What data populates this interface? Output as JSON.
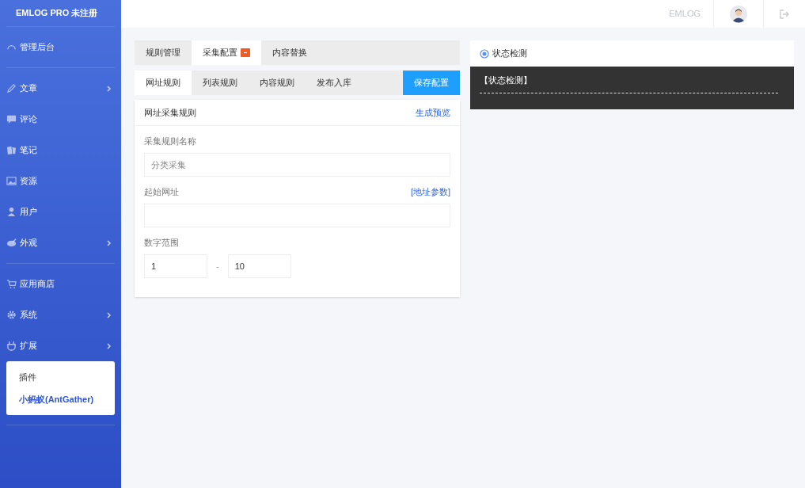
{
  "sidebar": {
    "brand": "EMLOG PRO 未注册",
    "sections": [
      [
        {
          "label": "管理后台",
          "expandable": false
        }
      ],
      [
        {
          "label": "文章",
          "expandable": true
        },
        {
          "label": "评论",
          "expandable": false
        },
        {
          "label": "笔记",
          "expandable": false
        },
        {
          "label": "资源",
          "expandable": false
        },
        {
          "label": "用户",
          "expandable": false
        },
        {
          "label": "外观",
          "expandable": true
        }
      ],
      [
        {
          "label": "应用商店",
          "expandable": false
        },
        {
          "label": "系统",
          "expandable": true
        },
        {
          "label": "扩展",
          "expandable": true,
          "expanded": true,
          "children": [
            {
              "label": "插件",
              "selected": false
            },
            {
              "label": "小蚂蚁(AntGather)",
              "selected": true
            }
          ]
        }
      ]
    ]
  },
  "header": {
    "site": "EMLOG"
  },
  "tabs": [
    {
      "label": "规则管理",
      "selected": false,
      "badge": false
    },
    {
      "label": "采集配置",
      "selected": true,
      "badge": true
    },
    {
      "label": "内容替换",
      "selected": false,
      "badge": false
    }
  ],
  "subtabs": [
    {
      "label": "网址规则",
      "selected": true
    },
    {
      "label": "列表规则",
      "selected": false
    },
    {
      "label": "内容规则",
      "selected": false
    },
    {
      "label": "发布入库",
      "selected": false
    }
  ],
  "save_button": "保存配置",
  "card": {
    "title": "网址采集规则",
    "action": "生成预览",
    "fields": [
      {
        "kind": "text",
        "label": "采集规则名称",
        "placeholder": "分类采集"
      },
      {
        "kind": "text",
        "label": "起始网址",
        "link": "[地址参数]"
      },
      {
        "kind": "range",
        "label": "数字范围",
        "from": "1",
        "separator": "-",
        "to": "10"
      }
    ]
  },
  "status_panel": {
    "title": "状态检测",
    "console": "【状态检测】"
  }
}
